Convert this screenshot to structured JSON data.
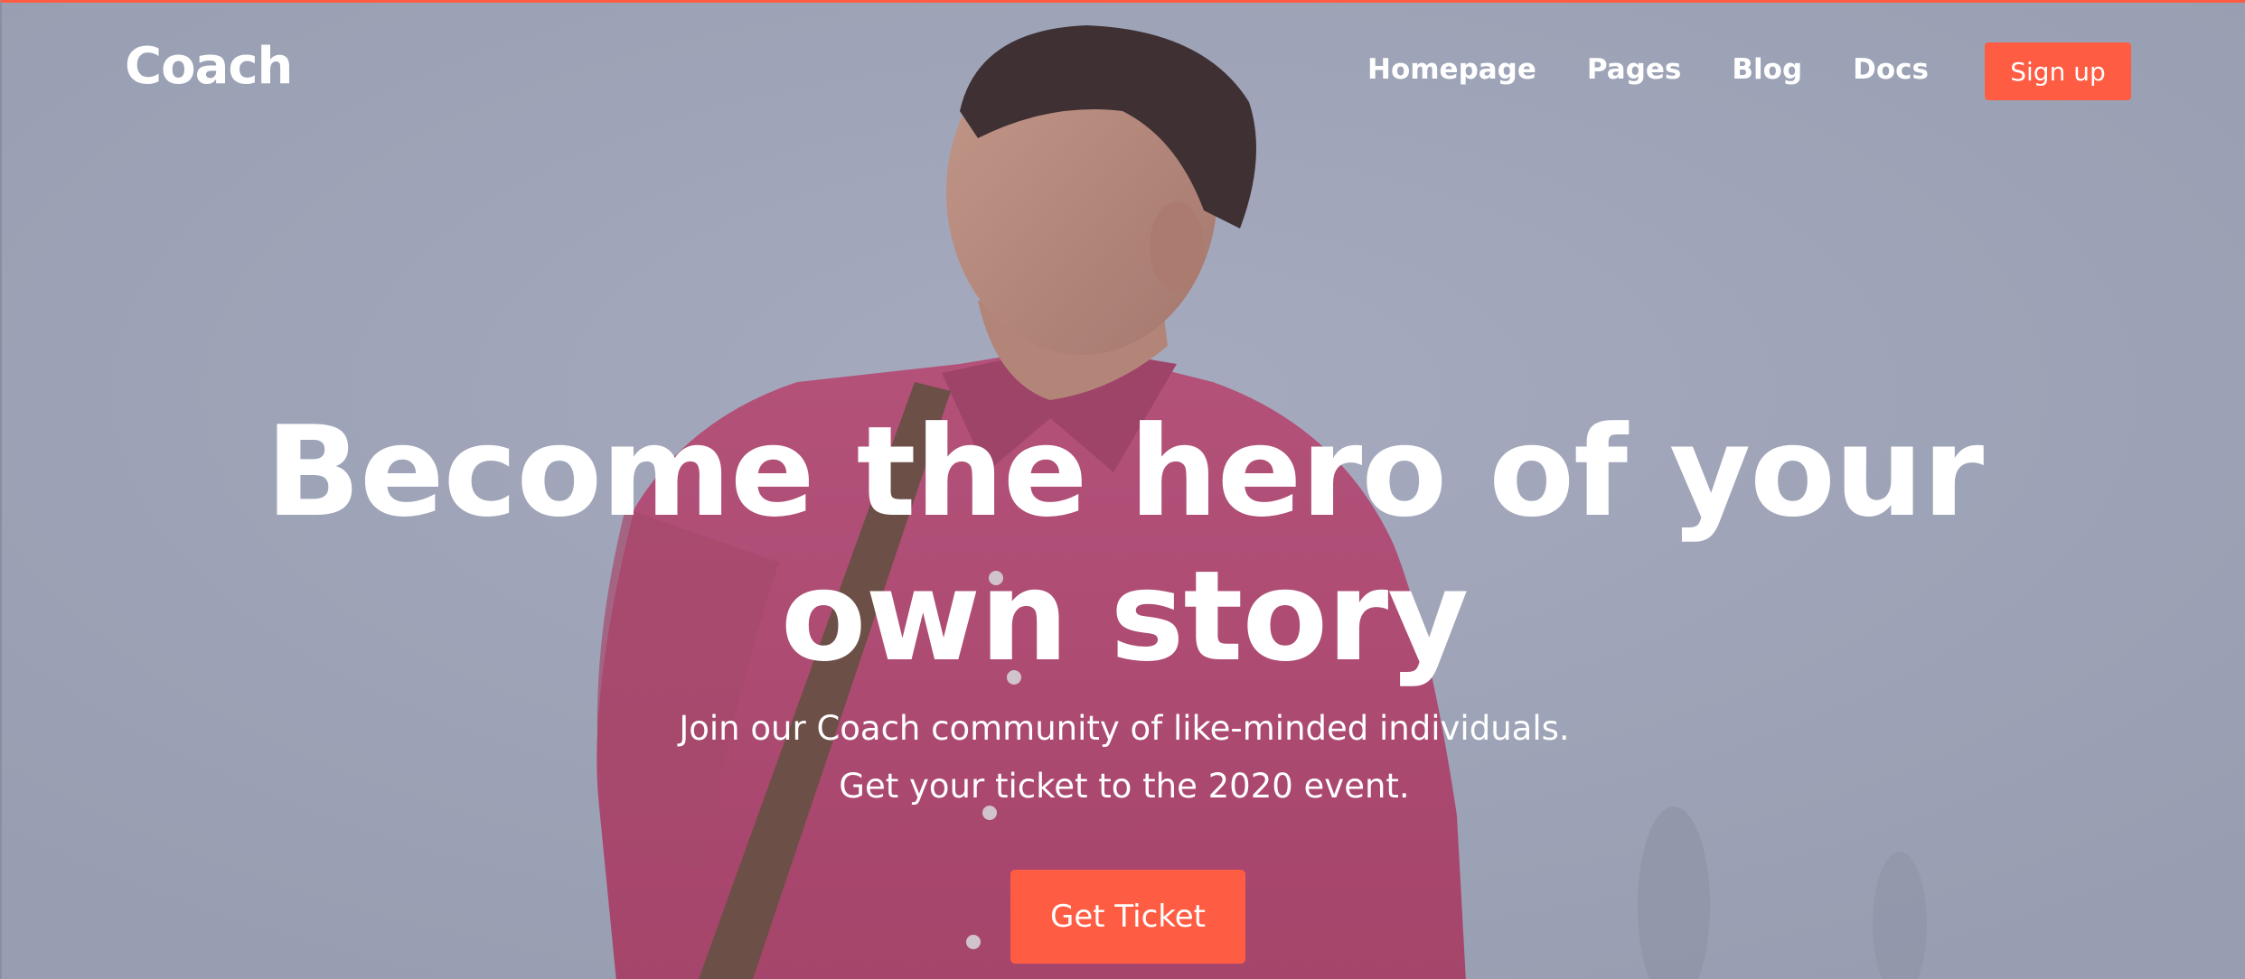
{
  "navbar": {
    "brand": "Coach",
    "links": [
      {
        "label": "Homepage"
      },
      {
        "label": "Pages"
      },
      {
        "label": "Blog"
      },
      {
        "label": "Docs"
      }
    ],
    "signup_label": "Sign up"
  },
  "hero": {
    "headline_line1": "Become the hero of your",
    "headline_line2": "own story",
    "subtext_line1": "Join our Coach community of like-minded individuals.",
    "subtext_line2": "Get your ticket to the 2020 event.",
    "cta_label": "Get Ticket",
    "background_image": "man-in-pink-shirt-photo"
  },
  "colors": {
    "accent": "#ff5c44",
    "text": "#ffffff",
    "background": "#a2a7b9",
    "shirt": "#b8486f"
  }
}
